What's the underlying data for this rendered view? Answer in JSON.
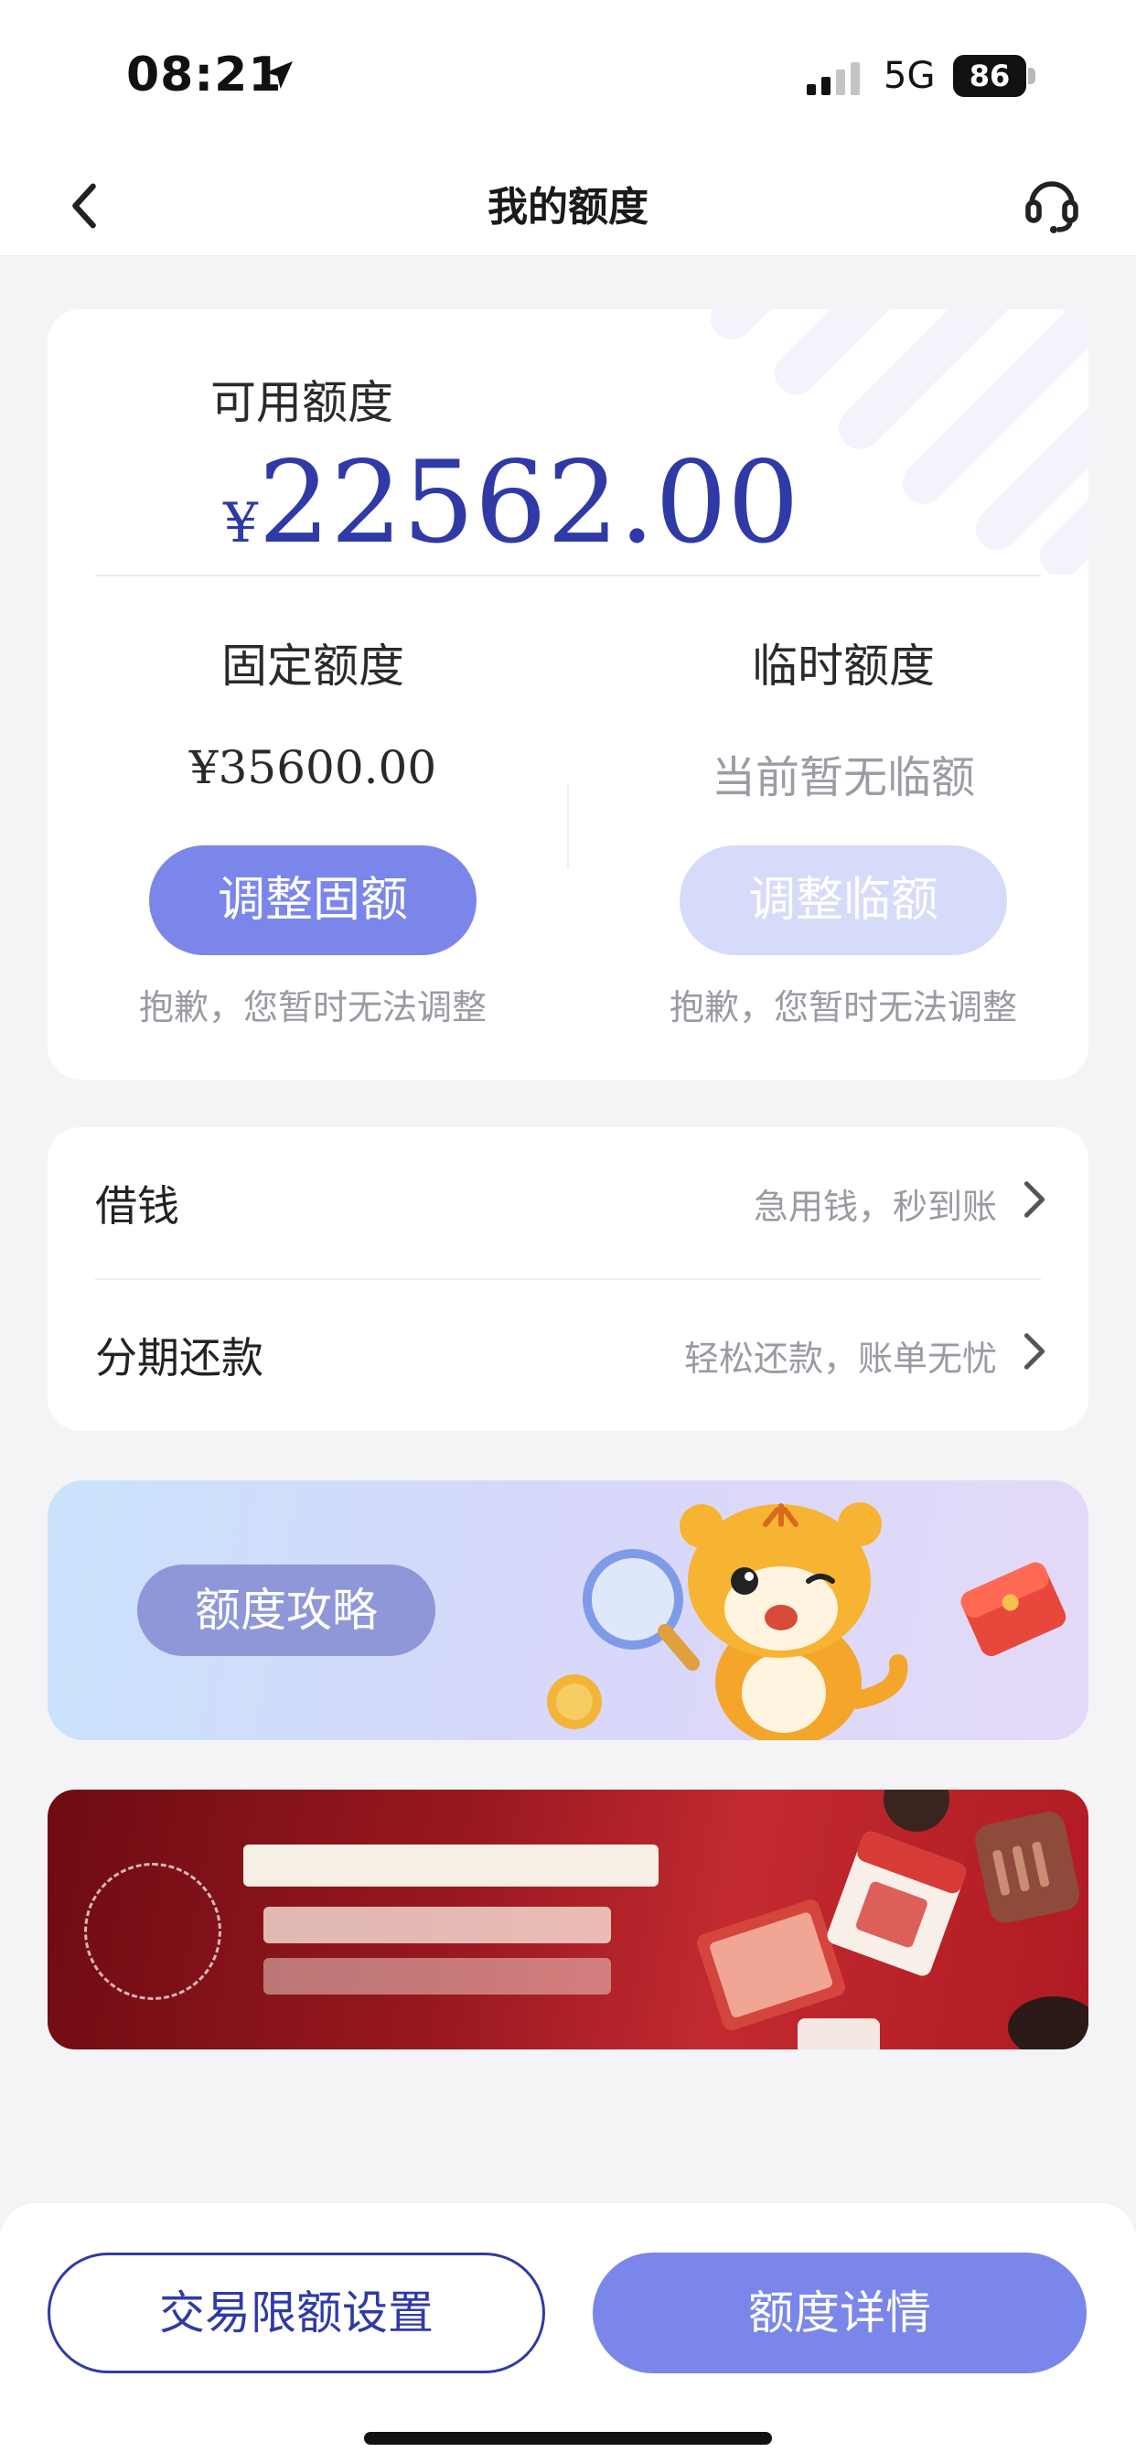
{
  "status_bar": {
    "time": "08:21",
    "network": "5G",
    "battery": "86"
  },
  "nav": {
    "title": "我的额度"
  },
  "limit_card": {
    "available_label": "可用额度",
    "currency": "¥",
    "available_value": "22562.00",
    "fixed": {
      "title": "固定额度",
      "value": "¥35600.00",
      "button": "调整固额",
      "note": "抱歉，您暂时无法调整"
    },
    "temporary": {
      "title": "临时额度",
      "value": "当前暂无临额",
      "button": "调整临额",
      "note": "抱歉，您暂时无法调整"
    }
  },
  "menu": {
    "items": [
      {
        "label": "借钱",
        "hint": "急用钱，秒到账"
      },
      {
        "label": "分期还款",
        "hint": "轻松还款，账单无忧"
      }
    ]
  },
  "strategy_banner": {
    "label": "额度攻略"
  },
  "bottom": {
    "left_button": "交易限额设置",
    "right_button": "额度详情"
  },
  "colors": {
    "brand_dark": "#2f3aa6",
    "brand_light": "#7b86ea",
    "disabled": "#d7dbfa",
    "page_bg": "#f4f4f7"
  }
}
